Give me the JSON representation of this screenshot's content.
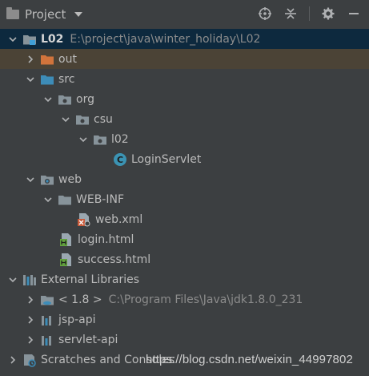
{
  "panel": {
    "title": "Project",
    "tools": [
      "locate-icon",
      "collapse-all-icon",
      "settings-icon",
      "hide-icon"
    ]
  },
  "tree": [
    {
      "name": "module-l02",
      "label": "L02",
      "path": "E:\\project\\java\\winter_holiday\\L02",
      "icon": "module-folder-icon",
      "expanded": true
    },
    {
      "name": "folder-out",
      "label": "out",
      "icon": "excluded-folder-icon",
      "expanded": false
    },
    {
      "name": "folder-src",
      "label": "src",
      "icon": "source-folder-icon",
      "expanded": true
    },
    {
      "name": "package-org",
      "label": "org",
      "icon": "package-icon",
      "expanded": true
    },
    {
      "name": "package-csu",
      "label": "csu",
      "icon": "package-icon",
      "expanded": true
    },
    {
      "name": "package-l02",
      "label": "l02",
      "icon": "package-icon",
      "expanded": true
    },
    {
      "name": "class-loginservlet",
      "label": "LoginServlet",
      "icon": "java-class-icon"
    },
    {
      "name": "folder-web",
      "label": "web",
      "icon": "web-folder-icon",
      "expanded": true
    },
    {
      "name": "folder-web-inf",
      "label": "WEB-INF",
      "icon": "folder-icon",
      "expanded": true
    },
    {
      "name": "file-web-xml",
      "label": "web.xml",
      "icon": "xml-file-icon"
    },
    {
      "name": "file-login-html",
      "label": "login.html",
      "icon": "html-file-icon"
    },
    {
      "name": "file-success-html",
      "label": "success.html",
      "icon": "html-file-icon"
    },
    {
      "name": "external-libraries",
      "label": "External Libraries",
      "icon": "libraries-icon",
      "expanded": true
    },
    {
      "name": "library-jdk",
      "label": "< 1.8 >",
      "path": "C:\\Program Files\\Java\\jdk1.8.0_231",
      "icon": "jdk-folder-icon",
      "expanded": false
    },
    {
      "name": "library-jsp-api",
      "label": "jsp-api",
      "icon": "library-icon",
      "expanded": false
    },
    {
      "name": "library-servlet-api",
      "label": "servlet-api",
      "icon": "library-icon",
      "expanded": false
    },
    {
      "name": "scratches",
      "label": "Scratches and Consoles",
      "icon": "scratches-icon",
      "expanded": false
    }
  ],
  "watermark": "https://blog.csdn.net/weixin_44997802",
  "colors": {
    "background": "#3c3f41",
    "selected": "#0d293e",
    "highlight": "#4b4336",
    "text": "#bbbbbb",
    "path": "#8c8c8c",
    "folder": "#87939a",
    "source_folder": "#3d8cb8",
    "excluded_folder": "#d1743c",
    "class_icon": "#3b93b3",
    "html_icon": "#61a03e"
  }
}
